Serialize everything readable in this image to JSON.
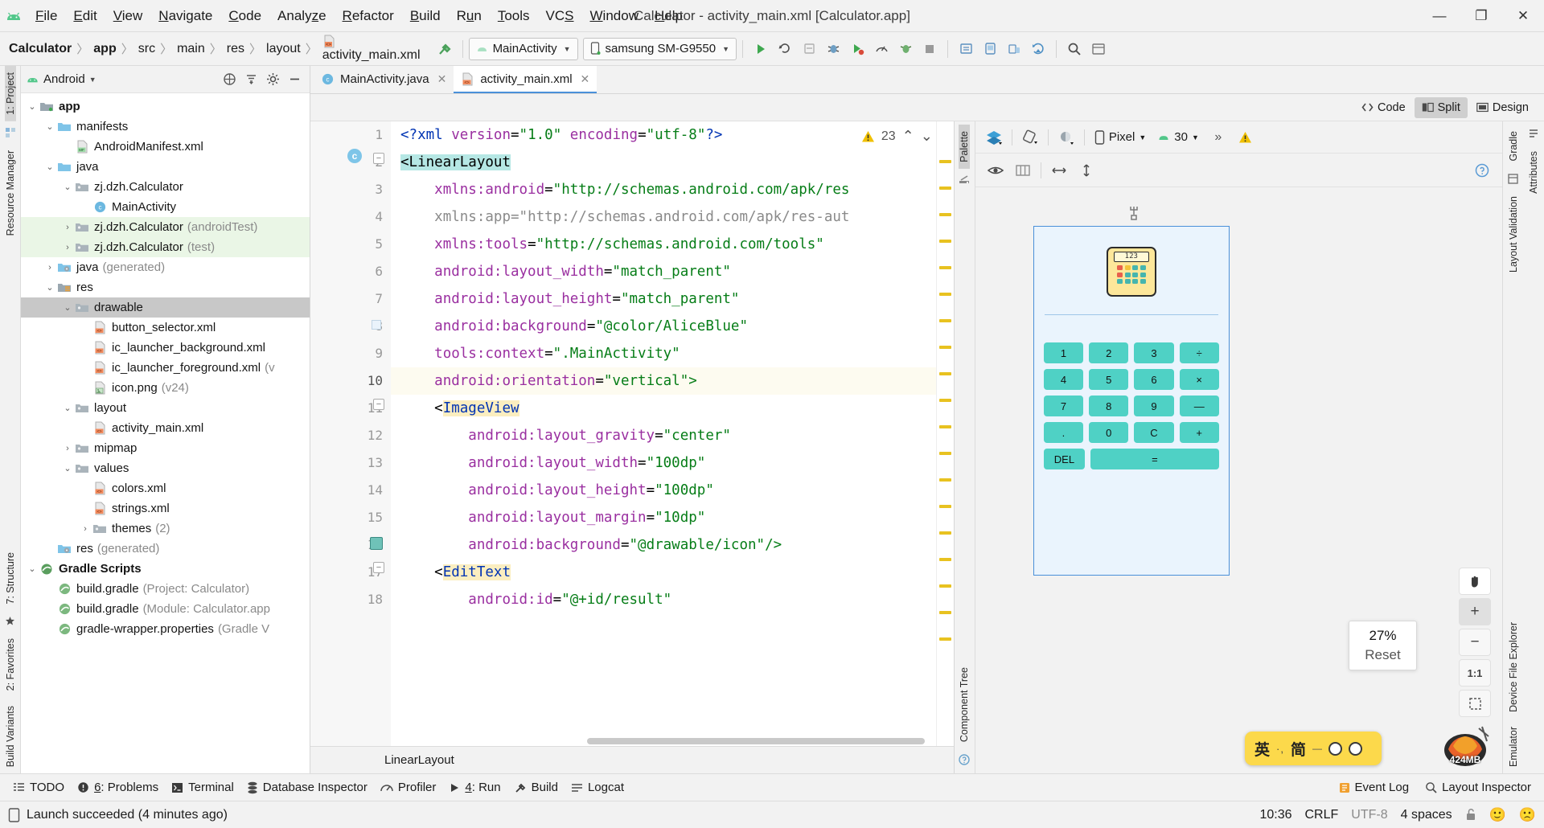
{
  "window": {
    "title": "Calculator - activity_main.xml [Calculator.app]",
    "minimize": "—",
    "maximize": "❐",
    "close": "✕"
  },
  "menubar": {
    "items": [
      {
        "label": "File",
        "mnemonic": "F"
      },
      {
        "label": "Edit",
        "mnemonic": "E"
      },
      {
        "label": "View",
        "mnemonic": "V"
      },
      {
        "label": "Navigate",
        "mnemonic": "N"
      },
      {
        "label": "Code",
        "mnemonic": "C"
      },
      {
        "label": "Analyze",
        "mnemonic": "z"
      },
      {
        "label": "Refactor",
        "mnemonic": "R"
      },
      {
        "label": "Build",
        "mnemonic": "B"
      },
      {
        "label": "Run",
        "mnemonic": "u"
      },
      {
        "label": "Tools",
        "mnemonic": "T"
      },
      {
        "label": "VCS",
        "mnemonic": "S"
      },
      {
        "label": "Window",
        "mnemonic": "W"
      },
      {
        "label": "Help",
        "mnemonic": "H"
      }
    ]
  },
  "navbar": {
    "breadcrumbs": [
      "Calculator",
      "app",
      "src",
      "main",
      "res",
      "layout",
      "activity_main.xml"
    ],
    "separator": "〉",
    "run_config": "MainActivity",
    "device": "samsung SM-G9550",
    "caret": "▼"
  },
  "left_rail": {
    "project_label": "1: Project",
    "resource_manager_label": "Resource Manager",
    "structure_label": "7: Structure",
    "favorites_label": "2: Favorites",
    "build_variants_label": "Build Variants"
  },
  "right_rail": {
    "gradle_label": "Gradle",
    "layout_validation_label": "Layout Validation",
    "device_file_explorer_label": "Device File Explorer",
    "emulator_label": "Emulator",
    "attributes_label": "Attributes"
  },
  "project_panel": {
    "title": "Android",
    "caret": "▼",
    "tree": [
      {
        "label": "app",
        "depth": 0,
        "arrow": "⌄",
        "icon": "module-folder",
        "bold": true
      },
      {
        "label": "manifests",
        "depth": 1,
        "arrow": "⌄",
        "icon": "folder-blue"
      },
      {
        "label": "AndroidManifest.xml",
        "depth": 2,
        "arrow": "",
        "icon": "manifest-file"
      },
      {
        "label": "java",
        "depth": 1,
        "arrow": "⌄",
        "icon": "folder-blue"
      },
      {
        "label": "zj.dzh.Calculator",
        "depth": 2,
        "arrow": "⌄",
        "icon": "package"
      },
      {
        "label": "MainActivity",
        "depth": 3,
        "arrow": "",
        "icon": "java-class"
      },
      {
        "label": "zj.dzh.Calculator",
        "suffix": "(androidTest)",
        "depth": 2,
        "arrow": "›",
        "icon": "package",
        "row": "green"
      },
      {
        "label": "zj.dzh.Calculator",
        "suffix": "(test)",
        "depth": 2,
        "arrow": "›",
        "icon": "package",
        "row": "green"
      },
      {
        "label": "java",
        "suffix": "(generated)",
        "depth": 1,
        "arrow": "›",
        "icon": "folder-generated"
      },
      {
        "label": "res",
        "depth": 1,
        "arrow": "⌄",
        "icon": "folder-res"
      },
      {
        "label": "drawable",
        "depth": 2,
        "arrow": "⌄",
        "icon": "package",
        "row": "selected"
      },
      {
        "label": "button_selector.xml",
        "depth": 3,
        "arrow": "",
        "icon": "xml-file"
      },
      {
        "label": "ic_launcher_background.xml",
        "depth": 3,
        "arrow": "",
        "icon": "xml-file"
      },
      {
        "label": "ic_launcher_foreground.xml",
        "suffix": "(v",
        "depth": 3,
        "arrow": "",
        "icon": "xml-file"
      },
      {
        "label": "icon.png",
        "suffix": "(v24)",
        "depth": 3,
        "arrow": "",
        "icon": "png-file"
      },
      {
        "label": "layout",
        "depth": 2,
        "arrow": "⌄",
        "icon": "package"
      },
      {
        "label": "activity_main.xml",
        "depth": 3,
        "arrow": "",
        "icon": "xml-file"
      },
      {
        "label": "mipmap",
        "depth": 2,
        "arrow": "›",
        "icon": "package"
      },
      {
        "label": "values",
        "depth": 2,
        "arrow": "⌄",
        "icon": "package"
      },
      {
        "label": "colors.xml",
        "depth": 3,
        "arrow": "",
        "icon": "xml-file"
      },
      {
        "label": "strings.xml",
        "depth": 3,
        "arrow": "",
        "icon": "xml-file"
      },
      {
        "label": "themes",
        "suffix": "(2)",
        "depth": 3,
        "arrow": "›",
        "icon": "package"
      },
      {
        "label": "res",
        "suffix": "(generated)",
        "depth": 1,
        "arrow": "",
        "icon": "folder-generated"
      },
      {
        "label": "Gradle Scripts",
        "depth": 0,
        "arrow": "⌄",
        "icon": "gradle",
        "bold": true
      },
      {
        "label": "build.gradle",
        "suffix": "(Project: Calculator)",
        "depth": 1,
        "arrow": "",
        "icon": "gradle-file"
      },
      {
        "label": "build.gradle",
        "suffix": "(Module: Calculator.app",
        "depth": 1,
        "arrow": "",
        "icon": "gradle-file"
      },
      {
        "label": "gradle-wrapper.properties",
        "suffix": "(Gradle V",
        "depth": 1,
        "arrow": "",
        "icon": "gradle-file"
      }
    ]
  },
  "editor": {
    "tabs": [
      {
        "label": "MainActivity.java",
        "icon": "java-class",
        "active": false,
        "close": "✕"
      },
      {
        "label": "activity_main.xml",
        "icon": "xml-file",
        "active": true,
        "close": "✕"
      }
    ],
    "modes": [
      {
        "label": "Code",
        "icon": "code-icon",
        "selected": false
      },
      {
        "label": "Split",
        "icon": "split-icon",
        "selected": true
      },
      {
        "label": "Design",
        "icon": "design-icon",
        "selected": false
      }
    ],
    "warning_count": "23",
    "warning_up": "⌃",
    "warning_down": "⌄",
    "component_path": "LinearLayout",
    "lines": [
      {
        "n": "1",
        "tokens": [
          {
            "t": "<?",
            "c": "k-pi"
          },
          {
            "t": "xml",
            "c": "k-name"
          },
          {
            "t": " ",
            "c": "k-tag"
          },
          {
            "t": "version",
            "c": "k-attr"
          },
          {
            "t": "=",
            "c": "k-eq"
          },
          {
            "t": "\"1.0\"",
            "c": "k-val"
          },
          {
            "t": " ",
            "c": "k-tag"
          },
          {
            "t": "encoding",
            "c": "k-attr"
          },
          {
            "t": "=",
            "c": "k-eq"
          },
          {
            "t": "\"utf-8\"",
            "c": "k-val"
          },
          {
            "t": "?>",
            "c": "k-pi"
          }
        ],
        "indent": 0
      },
      {
        "n": "2",
        "tokens": [
          {
            "t": "<LinearLayout",
            "c": "k-tag hl-cyan"
          }
        ],
        "indent": 0,
        "marker": "class",
        "fold": true
      },
      {
        "n": "3",
        "tokens": [
          {
            "t": "xmlns:android",
            "c": "k-attr"
          },
          {
            "t": "=",
            "c": "k-eq"
          },
          {
            "t": "\"http://schemas.android.com/apk/res",
            "c": "k-val"
          }
        ],
        "indent": 1
      },
      {
        "n": "4",
        "tokens": [
          {
            "t": "xmlns:app",
            "c": "k-dim"
          },
          {
            "t": "=",
            "c": "k-dim"
          },
          {
            "t": "\"http://schemas.android.com/apk/res-aut",
            "c": "k-dim"
          }
        ],
        "indent": 1
      },
      {
        "n": "5",
        "tokens": [
          {
            "t": "xmlns:tools",
            "c": "k-attr"
          },
          {
            "t": "=",
            "c": "k-eq"
          },
          {
            "t": "\"http://schemas.android.com/tools\"",
            "c": "k-val"
          }
        ],
        "indent": 1
      },
      {
        "n": "6",
        "tokens": [
          {
            "t": "android:layout_width",
            "c": "k-attr"
          },
          {
            "t": "=",
            "c": "k-eq"
          },
          {
            "t": "\"match_parent\"",
            "c": "k-val"
          }
        ],
        "indent": 1
      },
      {
        "n": "7",
        "tokens": [
          {
            "t": "android:layout_height",
            "c": "k-attr"
          },
          {
            "t": "=",
            "c": "k-eq"
          },
          {
            "t": "\"match_parent\"",
            "c": "k-val"
          }
        ],
        "indent": 1
      },
      {
        "n": "8",
        "tokens": [
          {
            "t": "android:background",
            "c": "k-attr"
          },
          {
            "t": "=",
            "c": "k-eq"
          },
          {
            "t": "\"@color/AliceBlue\"",
            "c": "k-val"
          }
        ],
        "indent": 1,
        "swatch": true
      },
      {
        "n": "9",
        "tokens": [
          {
            "t": "tools:context",
            "c": "k-attr"
          },
          {
            "t": "=",
            "c": "k-eq"
          },
          {
            "t": "\".MainActivity\"",
            "c": "k-val"
          }
        ],
        "indent": 1
      },
      {
        "n": "10",
        "tokens": [
          {
            "t": "android:orientation",
            "c": "k-attr"
          },
          {
            "t": "=",
            "c": "k-eq"
          },
          {
            "t": "\"vertical\">",
            "c": "k-val"
          }
        ],
        "indent": 1,
        "current": true
      },
      {
        "n": "11",
        "tokens": [
          {
            "t": "<",
            "c": "k-tag"
          },
          {
            "t": "ImageView",
            "c": "k-name hl-tan"
          }
        ],
        "indent": 1,
        "fold": true
      },
      {
        "n": "12",
        "tokens": [
          {
            "t": "android:layout_gravity",
            "c": "k-attr"
          },
          {
            "t": "=",
            "c": "k-eq"
          },
          {
            "t": "\"center\"",
            "c": "k-val"
          }
        ],
        "indent": 2
      },
      {
        "n": "13",
        "tokens": [
          {
            "t": "android:layout_width",
            "c": "k-attr"
          },
          {
            "t": "=",
            "c": "k-eq"
          },
          {
            "t": "\"100dp\"",
            "c": "k-val"
          }
        ],
        "indent": 2
      },
      {
        "n": "14",
        "tokens": [
          {
            "t": "android:layout_height",
            "c": "k-attr"
          },
          {
            "t": "=",
            "c": "k-eq"
          },
          {
            "t": "\"100dp\"",
            "c": "k-val"
          }
        ],
        "indent": 2
      },
      {
        "n": "15",
        "tokens": [
          {
            "t": "android:layout_margin",
            "c": "k-attr"
          },
          {
            "t": "=",
            "c": "k-eq"
          },
          {
            "t": "\"10dp\"",
            "c": "k-val"
          }
        ],
        "indent": 2
      },
      {
        "n": "16",
        "tokens": [
          {
            "t": "android:background",
            "c": "k-attr"
          },
          {
            "t": "=",
            "c": "k-eq"
          },
          {
            "t": "\"@drawable/icon\"/>",
            "c": "k-val"
          }
        ],
        "indent": 2,
        "image": true
      },
      {
        "n": "17",
        "tokens": [
          {
            "t": "<",
            "c": "k-tag"
          },
          {
            "t": "EditText",
            "c": "k-name hl-tan"
          }
        ],
        "indent": 1,
        "fold": true
      },
      {
        "n": "18",
        "tokens": [
          {
            "t": "android:id",
            "c": "k-attr"
          },
          {
            "t": "=",
            "c": "k-eq"
          },
          {
            "t": "\"@+id/result\"",
            "c": "k-val"
          }
        ],
        "indent": 2
      }
    ]
  },
  "palette_strip": {
    "palette_label": "Palette",
    "component_tree_label": "Component Tree"
  },
  "design_panel": {
    "device_name": "Pixel",
    "api_level": "30",
    "overflow": "»",
    "caret": "▼",
    "help": "?",
    "zoom_percent": "27%",
    "zoom_reset": "Reset",
    "zoom_in": "+",
    "zoom_out": "−",
    "zoom_fit": "1:1",
    "memory": "424MB"
  },
  "preview": {
    "calc_display": "123",
    "keys": [
      [
        "1",
        "2",
        "3",
        "÷"
      ],
      [
        "4",
        "5",
        "6",
        "×"
      ],
      [
        "7",
        "8",
        "9",
        "—"
      ],
      [
        ".",
        "0",
        "C",
        "+"
      ]
    ],
    "bottom_row": {
      "del": "DEL",
      "equals": "="
    },
    "button_color": "#4fd1c5",
    "background_color": "#eaf4fd"
  },
  "ime": {
    "language": "英",
    "dots": "·,",
    "mode": "简"
  },
  "bottom_toolbar": {
    "items": [
      {
        "label": "TODO",
        "icon": "todo-icon",
        "mnemonic": ""
      },
      {
        "label": "6: Problems",
        "icon": "problems-icon",
        "mnemonic": "6"
      },
      {
        "label": "Terminal",
        "icon": "terminal-icon",
        "mnemonic": ""
      },
      {
        "label": "Database Inspector",
        "icon": "database-icon",
        "mnemonic": ""
      },
      {
        "label": "Profiler",
        "icon": "profiler-icon",
        "mnemonic": ""
      },
      {
        "label": "4: Run",
        "icon": "run-icon",
        "mnemonic": "4"
      },
      {
        "label": "Build",
        "icon": "build-icon",
        "mnemonic": ""
      },
      {
        "label": "Logcat",
        "icon": "logcat-icon",
        "mnemonic": ""
      }
    ],
    "right_items": [
      {
        "label": "Event Log",
        "icon": "event-log-icon"
      },
      {
        "label": "Layout Inspector",
        "icon": "layout-inspector-icon"
      }
    ]
  },
  "statusbar": {
    "message": "Launch succeeded (4 minutes ago)",
    "time": "10:36",
    "line_separator": "CRLF",
    "encoding": "UTF-8",
    "indent": "4 spaces",
    "lock_icon": "🔓",
    "happy_face": "🙂",
    "sad_face": "🙁"
  }
}
